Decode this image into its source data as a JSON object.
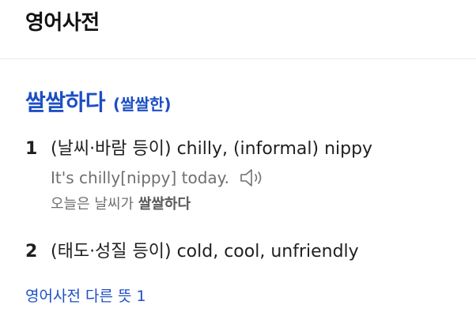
{
  "header": {
    "title": "영어사전"
  },
  "entry": {
    "headword": "쌀쌀하다",
    "variant": "(쌀쌀한)",
    "senses": [
      {
        "number": "1",
        "text": "(날씨·바람 등이) chilly, (informal) nippy",
        "example": {
          "english": "It's chilly[nippy] today.",
          "korean_prefix": "오늘은 날씨가 ",
          "korean_highlight": "쌀쌀하다",
          "audio_icon": "speaker-icon"
        }
      },
      {
        "number": "2",
        "text": "(태도·성질 등이) cold, cool, unfriendly"
      }
    ]
  },
  "footer": {
    "more_link": "영어사전 다른 뜻 1"
  },
  "colors": {
    "headword": "#1d4fc4",
    "link": "#1d4fc4",
    "text": "#1f1f1f",
    "example": "#6f6f6f",
    "divider": "#ebebeb"
  }
}
